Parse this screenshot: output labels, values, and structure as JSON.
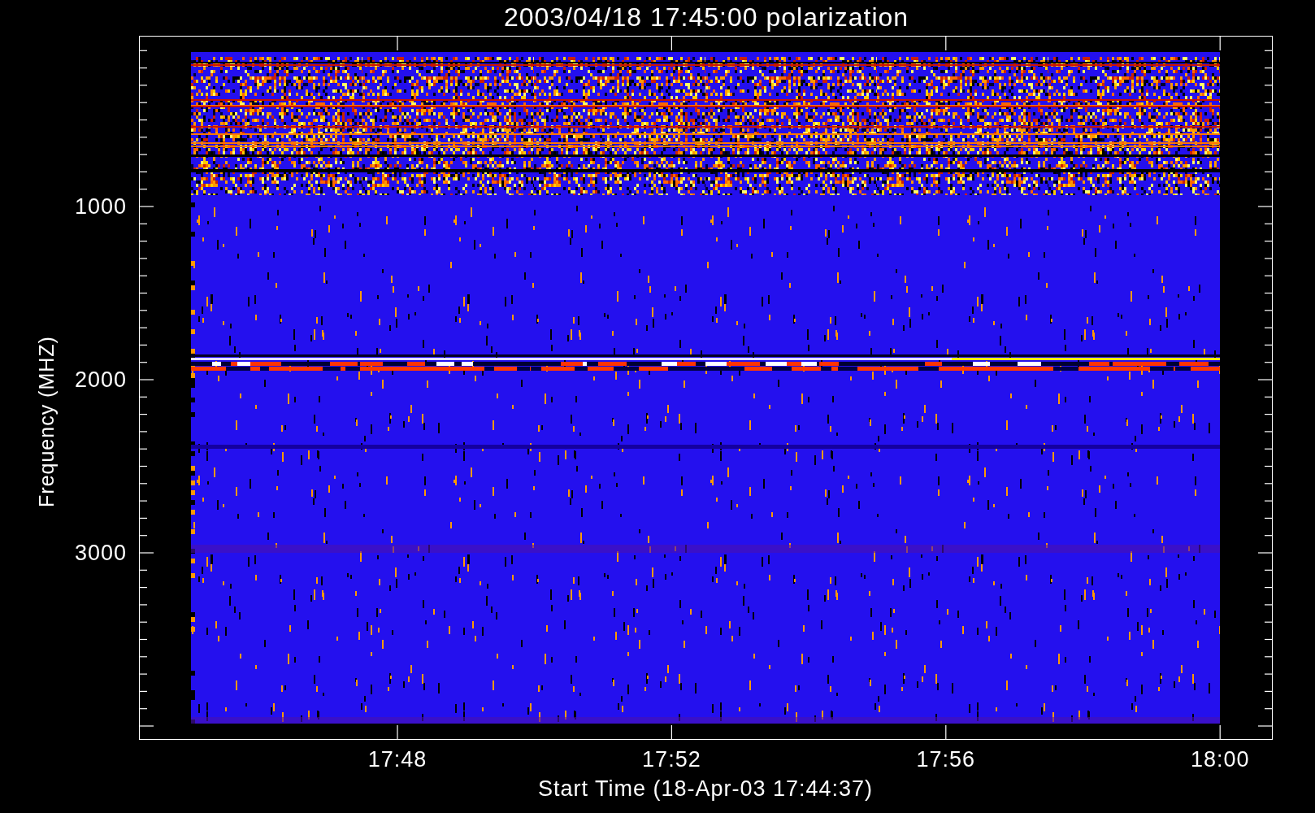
{
  "title": "2003/04/18 17:45:00 polarization",
  "y_axis": {
    "label": "Frequency (MHZ)",
    "ticks": [
      "1000",
      "2000",
      "3000"
    ]
  },
  "x_axis": {
    "label": "Start Time (18-Apr-03 17:44:37)",
    "ticks": [
      "17:48",
      "17:52",
      "17:56",
      "18:00"
    ]
  }
}
